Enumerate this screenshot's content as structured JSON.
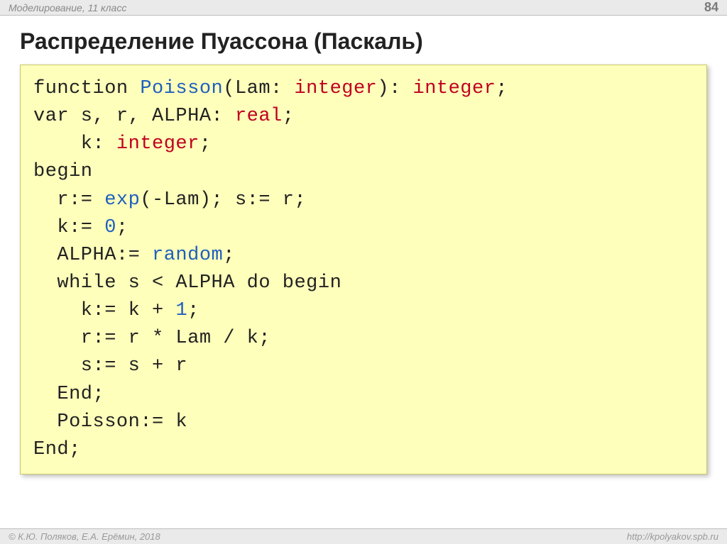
{
  "header": {
    "breadcrumb": "Моделирование, 11 класс",
    "page_number": "84"
  },
  "title": "Распределение Пуассона (Паскаль)",
  "code_tokens": [
    {
      "t": "function ",
      "c": "blk"
    },
    {
      "t": "Poisson",
      "c": "blue"
    },
    {
      "t": "(Lam: ",
      "c": "blk"
    },
    {
      "t": "integer",
      "c": "red"
    },
    {
      "t": "): ",
      "c": "blk"
    },
    {
      "t": "integer",
      "c": "red"
    },
    {
      "t": ";",
      "c": "blk"
    },
    {
      "t": "\n",
      "c": "br"
    },
    {
      "t": "var s, r, ALPHA: ",
      "c": "blk"
    },
    {
      "t": "real",
      "c": "red"
    },
    {
      "t": ";",
      "c": "blk"
    },
    {
      "t": "\n",
      "c": "br"
    },
    {
      "t": "    k: ",
      "c": "blk"
    },
    {
      "t": "integer",
      "c": "red"
    },
    {
      "t": ";",
      "c": "blk"
    },
    {
      "t": "\n",
      "c": "br"
    },
    {
      "t": "begin",
      "c": "blk"
    },
    {
      "t": "\n",
      "c": "br"
    },
    {
      "t": "  r:= ",
      "c": "blk"
    },
    {
      "t": "exp",
      "c": "blue"
    },
    {
      "t": "(-Lam); s:= r;",
      "c": "blk"
    },
    {
      "t": "\n",
      "c": "br"
    },
    {
      "t": "  k:= ",
      "c": "blk"
    },
    {
      "t": "0",
      "c": "num"
    },
    {
      "t": ";",
      "c": "blk"
    },
    {
      "t": "\n",
      "c": "br"
    },
    {
      "t": "  ALPHA:= ",
      "c": "blk"
    },
    {
      "t": "random",
      "c": "blue"
    },
    {
      "t": ";",
      "c": "blk"
    },
    {
      "t": "\n",
      "c": "br"
    },
    {
      "t": "  while s < ALPHA do begin",
      "c": "blk"
    },
    {
      "t": "\n",
      "c": "br"
    },
    {
      "t": "    k:= k + ",
      "c": "blk"
    },
    {
      "t": "1",
      "c": "num"
    },
    {
      "t": ";",
      "c": "blk"
    },
    {
      "t": "\n",
      "c": "br"
    },
    {
      "t": "    r:= r * Lam / k;",
      "c": "blk"
    },
    {
      "t": "\n",
      "c": "br"
    },
    {
      "t": "    s:= s + r",
      "c": "blk"
    },
    {
      "t": "\n",
      "c": "br"
    },
    {
      "t": "  End;",
      "c": "blk"
    },
    {
      "t": "\n",
      "c": "br"
    },
    {
      "t": "  Poisson:= k",
      "c": "blk"
    },
    {
      "t": "\n",
      "c": "br"
    },
    {
      "t": "End;",
      "c": "blk"
    }
  ],
  "footer": {
    "left": "© К.Ю. Поляков, Е.А. Ерёмин, 2018",
    "right": "http://kpolyakov.spb.ru"
  }
}
